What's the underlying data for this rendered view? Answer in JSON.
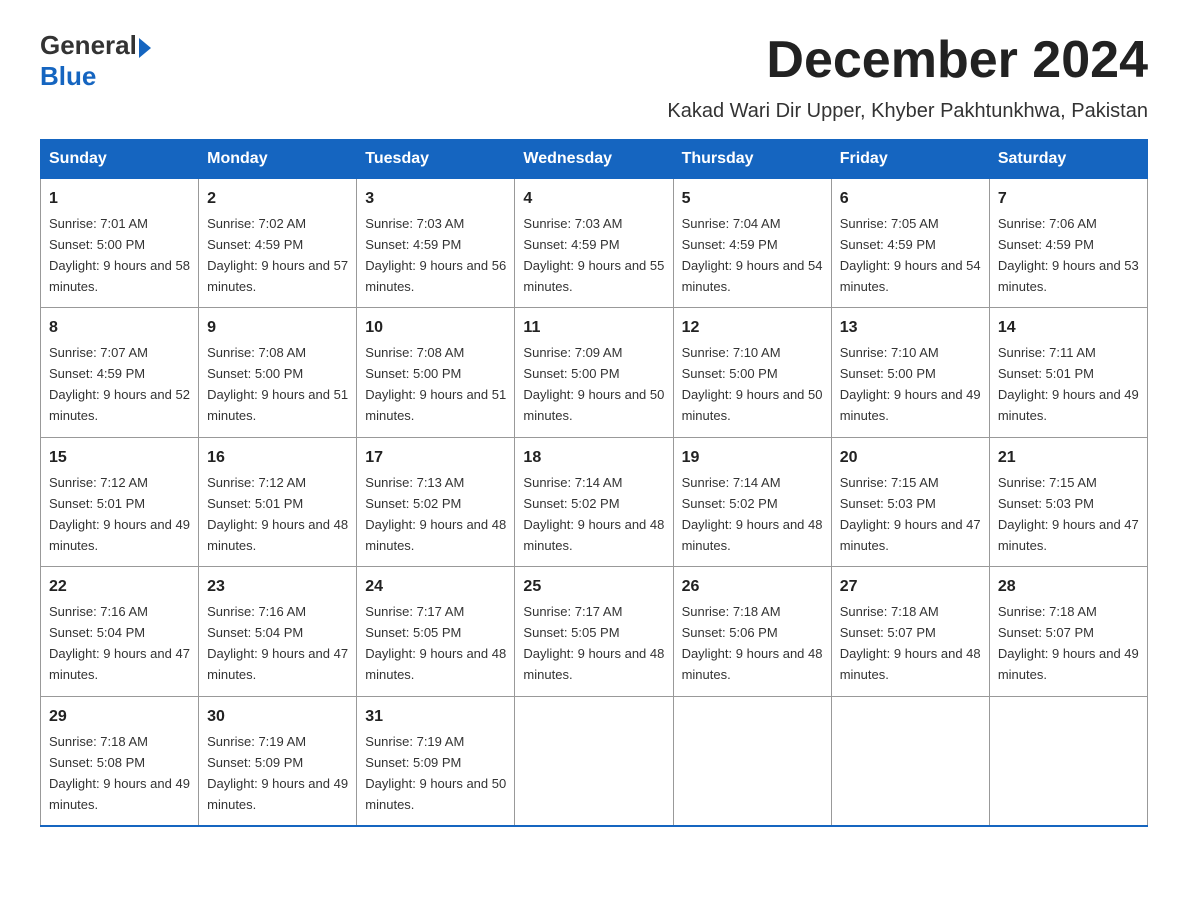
{
  "header": {
    "logo_general": "General",
    "logo_blue": "Blue",
    "month_title": "December 2024",
    "location": "Kakad Wari Dir Upper, Khyber Pakhtunkhwa, Pakistan"
  },
  "weekdays": [
    "Sunday",
    "Monday",
    "Tuesday",
    "Wednesday",
    "Thursday",
    "Friday",
    "Saturday"
  ],
  "weeks": [
    [
      {
        "day": "1",
        "sunrise": "7:01 AM",
        "sunset": "5:00 PM",
        "daylight": "9 hours and 58 minutes."
      },
      {
        "day": "2",
        "sunrise": "7:02 AM",
        "sunset": "4:59 PM",
        "daylight": "9 hours and 57 minutes."
      },
      {
        "day": "3",
        "sunrise": "7:03 AM",
        "sunset": "4:59 PM",
        "daylight": "9 hours and 56 minutes."
      },
      {
        "day": "4",
        "sunrise": "7:03 AM",
        "sunset": "4:59 PM",
        "daylight": "9 hours and 55 minutes."
      },
      {
        "day": "5",
        "sunrise": "7:04 AM",
        "sunset": "4:59 PM",
        "daylight": "9 hours and 54 minutes."
      },
      {
        "day": "6",
        "sunrise": "7:05 AM",
        "sunset": "4:59 PM",
        "daylight": "9 hours and 54 minutes."
      },
      {
        "day": "7",
        "sunrise": "7:06 AM",
        "sunset": "4:59 PM",
        "daylight": "9 hours and 53 minutes."
      }
    ],
    [
      {
        "day": "8",
        "sunrise": "7:07 AM",
        "sunset": "4:59 PM",
        "daylight": "9 hours and 52 minutes."
      },
      {
        "day": "9",
        "sunrise": "7:08 AM",
        "sunset": "5:00 PM",
        "daylight": "9 hours and 51 minutes."
      },
      {
        "day": "10",
        "sunrise": "7:08 AM",
        "sunset": "5:00 PM",
        "daylight": "9 hours and 51 minutes."
      },
      {
        "day": "11",
        "sunrise": "7:09 AM",
        "sunset": "5:00 PM",
        "daylight": "9 hours and 50 minutes."
      },
      {
        "day": "12",
        "sunrise": "7:10 AM",
        "sunset": "5:00 PM",
        "daylight": "9 hours and 50 minutes."
      },
      {
        "day": "13",
        "sunrise": "7:10 AM",
        "sunset": "5:00 PM",
        "daylight": "9 hours and 49 minutes."
      },
      {
        "day": "14",
        "sunrise": "7:11 AM",
        "sunset": "5:01 PM",
        "daylight": "9 hours and 49 minutes."
      }
    ],
    [
      {
        "day": "15",
        "sunrise": "7:12 AM",
        "sunset": "5:01 PM",
        "daylight": "9 hours and 49 minutes."
      },
      {
        "day": "16",
        "sunrise": "7:12 AM",
        "sunset": "5:01 PM",
        "daylight": "9 hours and 48 minutes."
      },
      {
        "day": "17",
        "sunrise": "7:13 AM",
        "sunset": "5:02 PM",
        "daylight": "9 hours and 48 minutes."
      },
      {
        "day": "18",
        "sunrise": "7:14 AM",
        "sunset": "5:02 PM",
        "daylight": "9 hours and 48 minutes."
      },
      {
        "day": "19",
        "sunrise": "7:14 AM",
        "sunset": "5:02 PM",
        "daylight": "9 hours and 48 minutes."
      },
      {
        "day": "20",
        "sunrise": "7:15 AM",
        "sunset": "5:03 PM",
        "daylight": "9 hours and 47 minutes."
      },
      {
        "day": "21",
        "sunrise": "7:15 AM",
        "sunset": "5:03 PM",
        "daylight": "9 hours and 47 minutes."
      }
    ],
    [
      {
        "day": "22",
        "sunrise": "7:16 AM",
        "sunset": "5:04 PM",
        "daylight": "9 hours and 47 minutes."
      },
      {
        "day": "23",
        "sunrise": "7:16 AM",
        "sunset": "5:04 PM",
        "daylight": "9 hours and 47 minutes."
      },
      {
        "day": "24",
        "sunrise": "7:17 AM",
        "sunset": "5:05 PM",
        "daylight": "9 hours and 48 minutes."
      },
      {
        "day": "25",
        "sunrise": "7:17 AM",
        "sunset": "5:05 PM",
        "daylight": "9 hours and 48 minutes."
      },
      {
        "day": "26",
        "sunrise": "7:18 AM",
        "sunset": "5:06 PM",
        "daylight": "9 hours and 48 minutes."
      },
      {
        "day": "27",
        "sunrise": "7:18 AM",
        "sunset": "5:07 PM",
        "daylight": "9 hours and 48 minutes."
      },
      {
        "day": "28",
        "sunrise": "7:18 AM",
        "sunset": "5:07 PM",
        "daylight": "9 hours and 49 minutes."
      }
    ],
    [
      {
        "day": "29",
        "sunrise": "7:18 AM",
        "sunset": "5:08 PM",
        "daylight": "9 hours and 49 minutes."
      },
      {
        "day": "30",
        "sunrise": "7:19 AM",
        "sunset": "5:09 PM",
        "daylight": "9 hours and 49 minutes."
      },
      {
        "day": "31",
        "sunrise": "7:19 AM",
        "sunset": "5:09 PM",
        "daylight": "9 hours and 50 minutes."
      },
      null,
      null,
      null,
      null
    ]
  ]
}
